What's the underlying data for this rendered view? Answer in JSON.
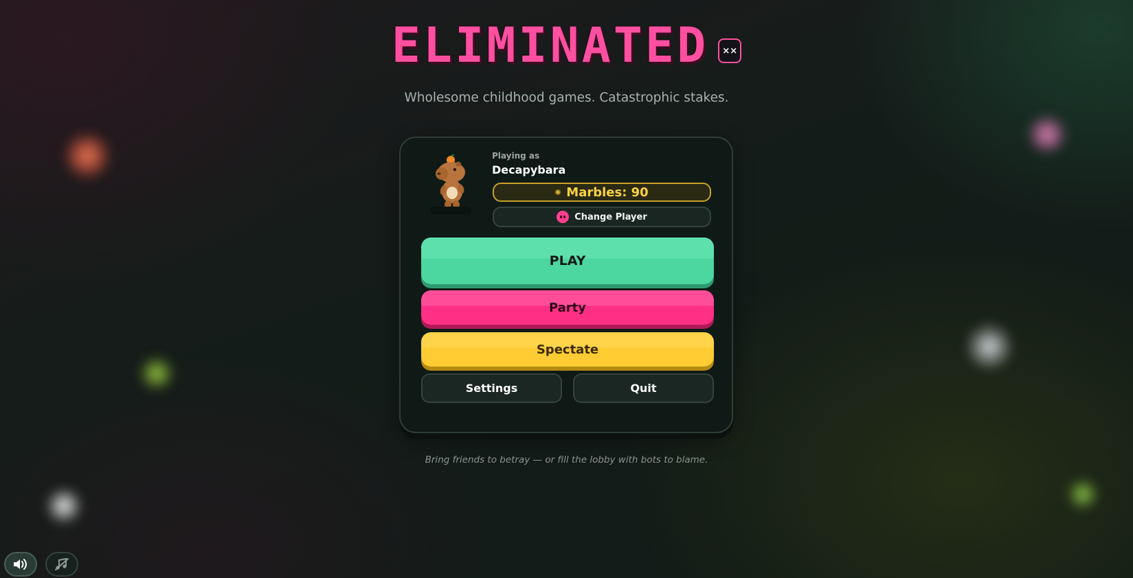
{
  "header": {
    "title": "ELIMINATED",
    "badge": "××",
    "subtitle": "Wholesome childhood games. Catastrophic stakes."
  },
  "player": {
    "playing_as_label": "Playing as",
    "name": "Decapybara",
    "marbles_label": "Marbles: 90",
    "marbles_count": 90,
    "change_player_label": "Change Player"
  },
  "menu": {
    "play_label": "PLAY",
    "party_label": "Party",
    "spectate_label": "Spectate",
    "settings_label": "Settings",
    "quit_label": "Quit"
  },
  "footer": {
    "note": "Bring friends to betray — or fill the lobby with bots to blame."
  },
  "controls": {
    "sound_icon": "speaker-icon",
    "music_icon": "music-muted-icon"
  },
  "colors": {
    "accent_pink": "#ff4fa0",
    "play_green": "#4cd6a0",
    "party_pink": "#ff2f86",
    "spectate_yellow": "#ffcc33",
    "marbles_gold": "#ffd23f"
  }
}
